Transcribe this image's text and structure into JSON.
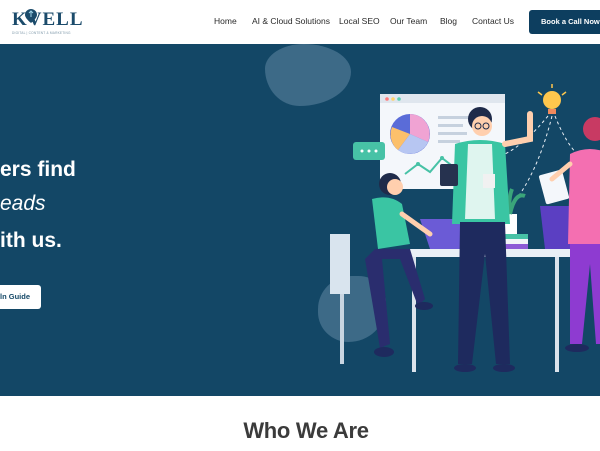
{
  "brand": {
    "name": "KVELL",
    "tagline": "DIGITAL | CONTENT & MARKETING",
    "primary": "#134766",
    "accent": "#0d3e5f"
  },
  "nav": {
    "items": [
      "Home",
      "AI & Cloud Solutions",
      "Local SEO",
      "Our Team",
      "Blog",
      "Contact Us"
    ],
    "cta": "Book a Call Now"
  },
  "hero": {
    "line1": "ers find",
    "line2": "eads",
    "line3": "ith us.",
    "button": "ln Guide"
  },
  "section": {
    "title": "Who We Are"
  }
}
